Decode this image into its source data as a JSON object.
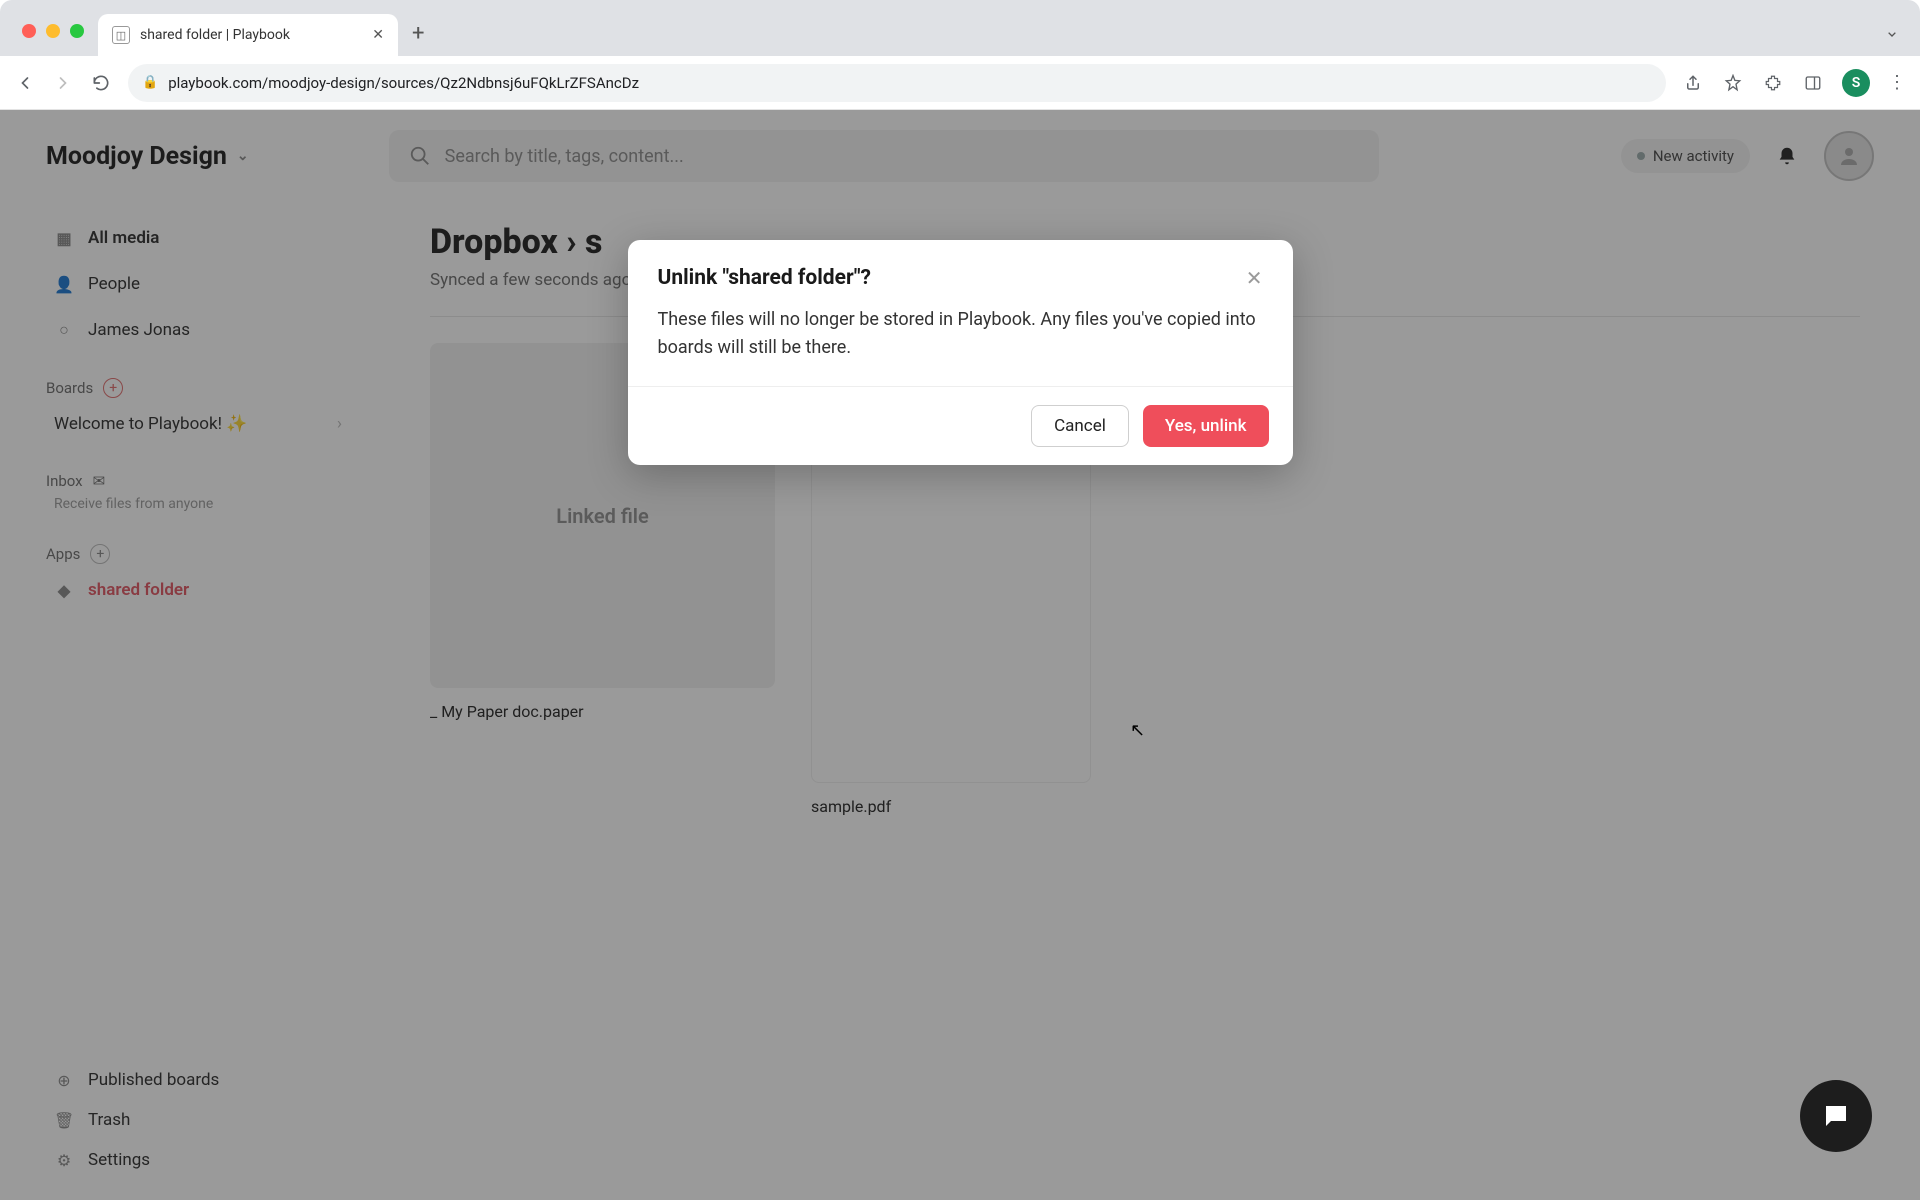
{
  "browser": {
    "tab_title": "shared folder | Playbook",
    "url": "playbook.com/moodjoy-design/sources/Qz2Ndbnsj6uFQkLrZFSAncDz",
    "avatar_initial": "S"
  },
  "header": {
    "workspace": "Moodjoy Design",
    "search_placeholder": "Search by title, tags, content...",
    "new_activity": "New activity"
  },
  "sidebar": {
    "all_media": "All media",
    "people": "People",
    "person": "James Jonas",
    "boards_label": "Boards",
    "board1": "Welcome to Playbook! ✨",
    "inbox_label": "Inbox",
    "inbox_sub": "Receive files from anyone",
    "apps_label": "Apps",
    "app1": "shared folder",
    "published": "Published boards",
    "trash": "Trash",
    "settings": "Settings"
  },
  "main": {
    "breadcrumb": "Dropbox › s",
    "synced": "Synced a few seconds ago",
    "file1_thumb": "Linked file",
    "file1_name": "_ My Paper doc.paper",
    "file2_name": "sample.pdf"
  },
  "modal": {
    "title": "Unlink \"shared folder\"?",
    "body": "These files will no longer be stored in Playbook. Any files you've copied into boards will still be there.",
    "cancel": "Cancel",
    "confirm": "Yes, unlink"
  }
}
